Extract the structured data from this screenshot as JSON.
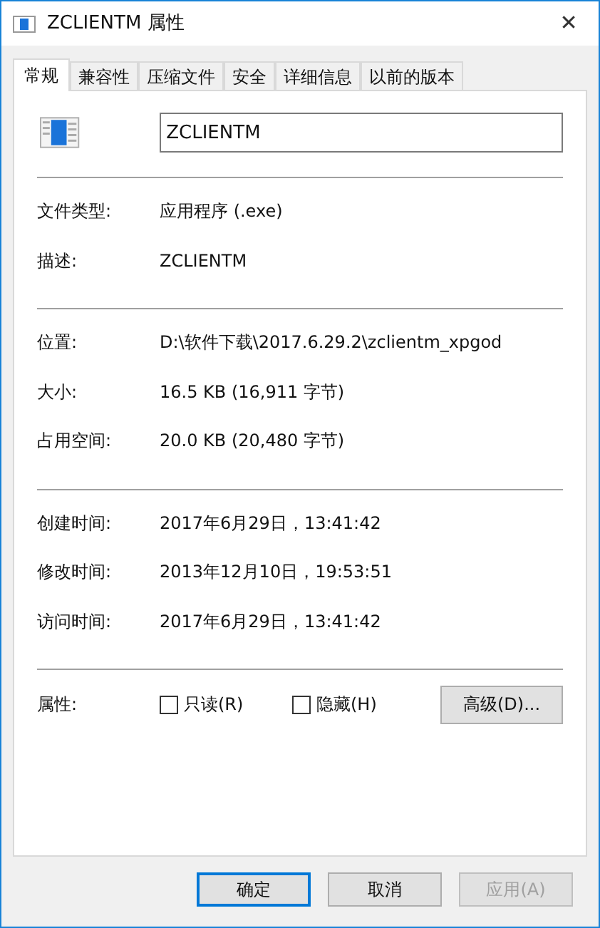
{
  "window": {
    "title": "ZCLIENTM 属性",
    "close": "✕"
  },
  "tabs": [
    {
      "label": "常规",
      "selected": true
    },
    {
      "label": "兼容性",
      "selected": false
    },
    {
      "label": "压缩文件",
      "selected": false
    },
    {
      "label": "安全",
      "selected": false
    },
    {
      "label": "详细信息",
      "selected": false
    },
    {
      "label": "以前的版本",
      "selected": false
    }
  ],
  "name_field": {
    "value": "ZCLIENTM"
  },
  "sections": [
    [
      {
        "label": "文件类型:",
        "value": "应用程序 (.exe)"
      },
      {
        "label": "描述:",
        "value": "ZCLIENTM"
      }
    ],
    [
      {
        "label": "位置:",
        "value": "D:\\软件下载\\2017.6.29.2\\zclientm_xpgod"
      },
      {
        "label": "大小:",
        "value": "16.5 KB (16,911 字节)"
      },
      {
        "label": "占用空间:",
        "value": "20.0 KB (20,480 字节)"
      }
    ],
    [
      {
        "label": "创建时间:",
        "value": "2017年6月29日，13:41:42"
      },
      {
        "label": "修改时间:",
        "value": "2013年12月10日，19:53:51"
      },
      {
        "label": "访问时间:",
        "value": "2017年6月29日，13:41:42"
      }
    ]
  ],
  "attributes": {
    "label": "属性:",
    "checkboxes": [
      {
        "label": "只读(R)",
        "checked": false
      },
      {
        "label": "隐藏(H)",
        "checked": false
      }
    ],
    "advanced": "高级(D)..."
  },
  "buttons": [
    {
      "label": "确定",
      "default": true,
      "disabled": false
    },
    {
      "label": "取消",
      "default": false,
      "disabled": false
    },
    {
      "label": "应用(A)",
      "default": false,
      "disabled": true
    }
  ]
}
